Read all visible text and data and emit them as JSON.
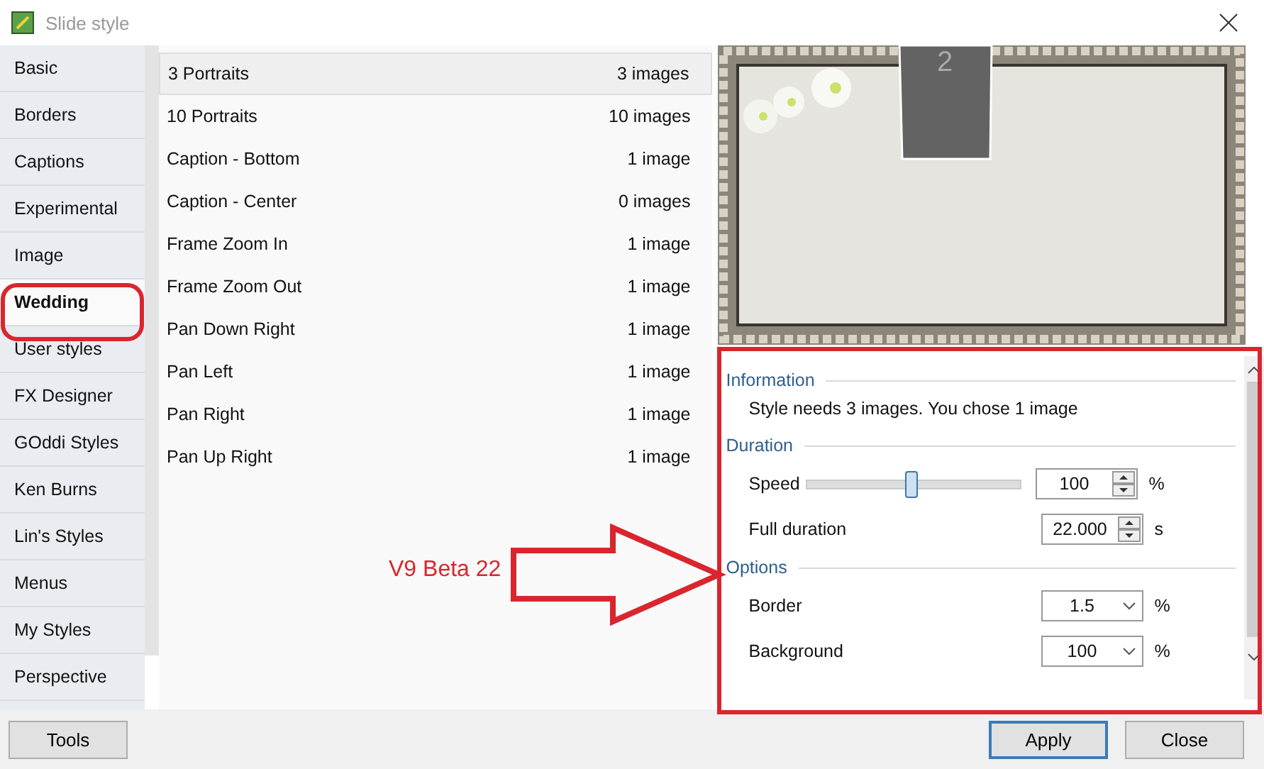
{
  "window": {
    "title": "Slide style"
  },
  "categories": [
    {
      "label": "Basic",
      "selected": false
    },
    {
      "label": "Borders",
      "selected": false
    },
    {
      "label": "Captions",
      "selected": false
    },
    {
      "label": "Experimental",
      "selected": false
    },
    {
      "label": "Image",
      "selected": false
    },
    {
      "label": "Wedding",
      "selected": true
    },
    {
      "label": "User styles",
      "selected": false
    },
    {
      "label": "FX Designer",
      "selected": false
    },
    {
      "label": "GOddi Styles",
      "selected": false
    },
    {
      "label": "Ken Burns",
      "selected": false
    },
    {
      "label": "Lin's Styles",
      "selected": false
    },
    {
      "label": "Menus",
      "selected": false
    },
    {
      "label": "My Styles",
      "selected": false
    },
    {
      "label": "Perspective",
      "selected": false
    }
  ],
  "styles": [
    {
      "name": "3 Portraits",
      "count": "3 images",
      "selected": true
    },
    {
      "name": "10 Portraits",
      "count": "10 images",
      "selected": false
    },
    {
      "name": "Caption - Bottom",
      "count": "1 image",
      "selected": false
    },
    {
      "name": "Caption - Center",
      "count": "0 images",
      "selected": false
    },
    {
      "name": "Frame Zoom In",
      "count": "1 image",
      "selected": false
    },
    {
      "name": "Frame Zoom Out",
      "count": "1 image",
      "selected": false
    },
    {
      "name": "Pan Down Right",
      "count": "1 image",
      "selected": false
    },
    {
      "name": "Pan Left",
      "count": "1 image",
      "selected": false
    },
    {
      "name": "Pan Right",
      "count": "1 image",
      "selected": false
    },
    {
      "name": "Pan Up Right",
      "count": "1 image",
      "selected": false
    }
  ],
  "preview": {
    "slot_number": "2"
  },
  "settings": {
    "sections": [
      {
        "title": "Information",
        "rows": [
          {
            "kind": "text",
            "text": "Style needs 3 images. You chose 1 image"
          }
        ]
      },
      {
        "title": "Duration",
        "rows": [
          {
            "kind": "slider",
            "label": "Speed",
            "level": 0.49,
            "value": "100",
            "unit": "%"
          },
          {
            "kind": "spin",
            "label": "Full duration",
            "value": "22.000",
            "unit": "s"
          }
        ]
      },
      {
        "title": "Options",
        "rows": [
          {
            "kind": "dropdown",
            "label": "Border",
            "value": "1.5",
            "unit": "%"
          },
          {
            "kind": "dropdown",
            "label": "Background",
            "value": "100",
            "unit": "%"
          }
        ]
      }
    ]
  },
  "annotation": {
    "text": "V9 Beta 22"
  },
  "buttons": {
    "tools": "Tools",
    "apply": "Apply",
    "close": "Close"
  }
}
